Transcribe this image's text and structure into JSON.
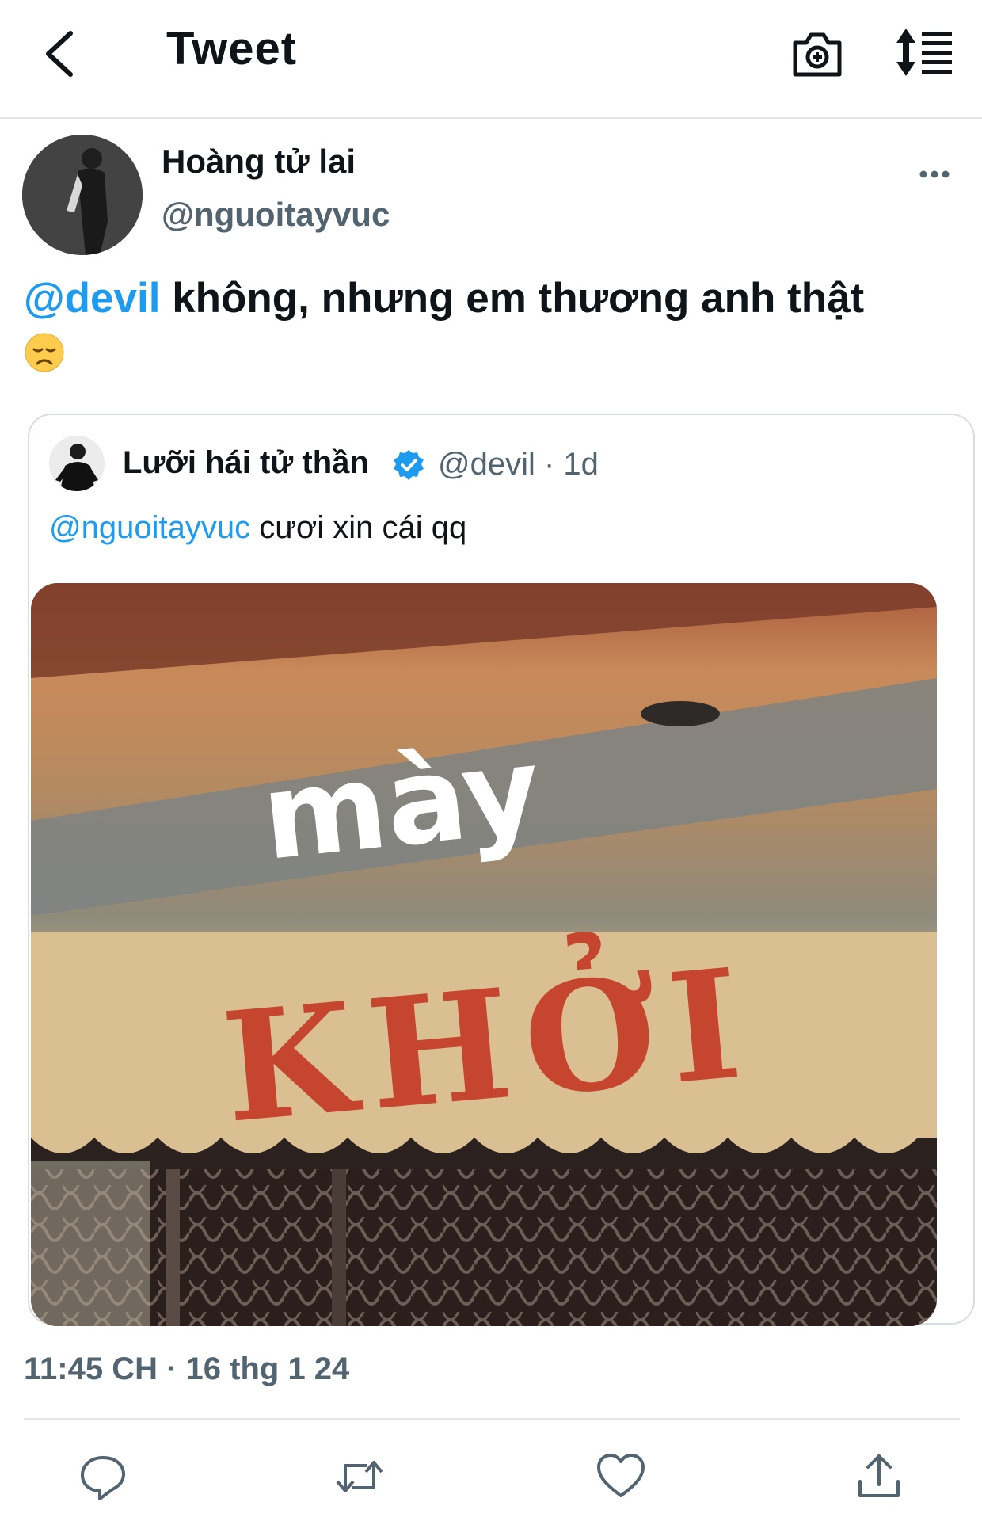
{
  "header": {
    "title": "Tweet",
    "icons": [
      "back-chevron-icon",
      "camera-add-icon",
      "sort-lines-icon"
    ]
  },
  "tweet": {
    "author": {
      "display_name": "Hoàng tử lai",
      "handle": "@nguoitayvuc"
    },
    "mention": "@devil",
    "text": " không, nhưng em thương anh thật",
    "emoji": "disappointed-face-emoji",
    "timestamp": "11:45 CH · 16 thg 1 24"
  },
  "quoted": {
    "display_name": "Lưỡi hái tử thần",
    "verified": true,
    "handle_meta": "@devil · 1d",
    "mention": "@nguoitayvuc",
    "text": " cươi xin cái qq",
    "image": {
      "caption_overlay": "mày",
      "sign_text": "KHỞI"
    }
  },
  "actions": [
    "reply-icon",
    "retweet-icon",
    "like-icon",
    "share-icon"
  ],
  "colors": {
    "accent": "#1d9bf0",
    "secondary_text": "#536471",
    "border": "#e1e6ea"
  }
}
